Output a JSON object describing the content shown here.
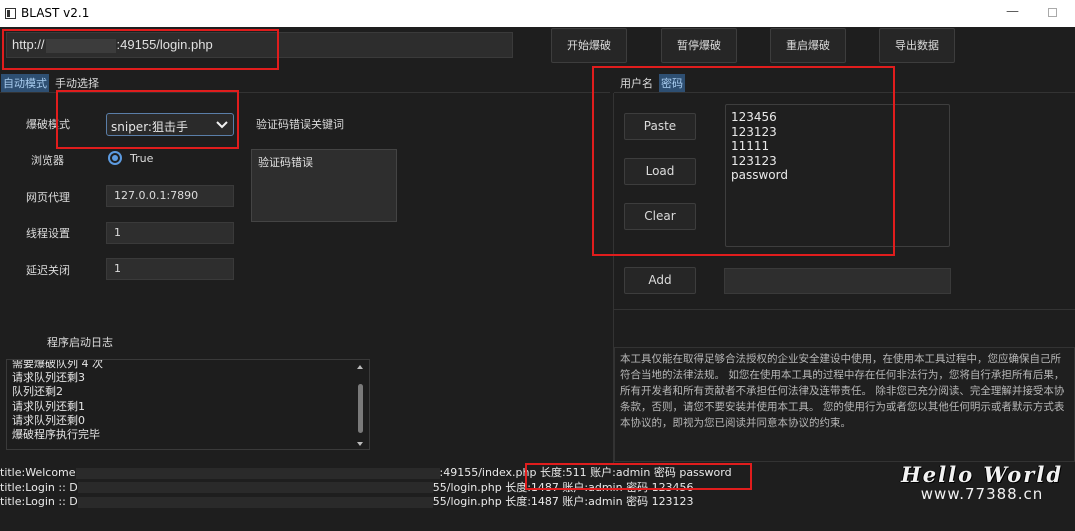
{
  "window": {
    "title": "BLAST v2.1",
    "minimize_glyph": "—"
  },
  "url": {
    "prefix": "http://",
    "suffix": ":49155/login.php"
  },
  "toolbar": {
    "start": "开始爆破",
    "pause": "暂停爆破",
    "restart": "重启爆破",
    "export": "导出数据"
  },
  "tabs": {
    "auto": "自动模式",
    "manual": "手动选择"
  },
  "form": {
    "mode_label": "爆破模式",
    "mode_value": "sniper:狙击手",
    "browser_label": "浏览器",
    "browser_value": "True",
    "proxy_label": "网页代理",
    "proxy_value": "127.0.0.1:7890",
    "threads_label": "线程设置",
    "threads_value": "1",
    "delay_label": "延迟关闭",
    "delay_value": "1",
    "captcha_label": "验证码错误关键词",
    "captcha_value": "验证码错误"
  },
  "log": {
    "title": "程序启动日志",
    "lines": [
      "需要爆破队列 4 次",
      "请求队列还剩3",
      "队列还剩2",
      "请求队列还剩1",
      "请求队列还剩0",
      "爆破程序执行完毕"
    ]
  },
  "dict_tabs": {
    "username": "用户名",
    "password": "密码"
  },
  "dict_buttons": {
    "paste": "Paste",
    "load": "Load",
    "clear": "Clear",
    "add": "Add"
  },
  "passwords": [
    "123456",
    "123123",
    "11111",
    "123123",
    "password"
  ],
  "disclaimer": [
    "本工具仅能在取得足够合法授权的企业安全建设中使用，在使用本工具过程中，您应确保自己所",
    "符合当地的法律法规。 如您在使用本工具的过程中存在任何非法行为，您将自行承担所有后果，",
    "所有开发者和所有贡献者不承担任何法律及连带责任。 除非您已充分阅读、完全理解并接受本协",
    "条款，否则，请您不要安装并使用本工具。 您的使用行为或者您以其他任何明示或者默示方式表",
    "本协议的，即视为您已阅读并同意本协议的约束。"
  ],
  "status": [
    {
      "prefix": "title:Welcome",
      "suffix": ":49155/index.php",
      "result": "长度:511 账户:admin 密码 password"
    },
    {
      "prefix": "title:Login :: D",
      "suffix": "55/login.php",
      "result": "长度:1487 账户:admin 密码 123456"
    },
    {
      "prefix": "title:Login :: D",
      "suffix": "55/login.php",
      "result": "长度:1487 账户:admin 密码 123123"
    }
  ],
  "watermark": {
    "line1": "Hello World",
    "line2": "www.77388.cn"
  },
  "colors": {
    "accent": "#5d9be0",
    "highlight": "#e01d1d",
    "background": "#1e1e1e"
  }
}
